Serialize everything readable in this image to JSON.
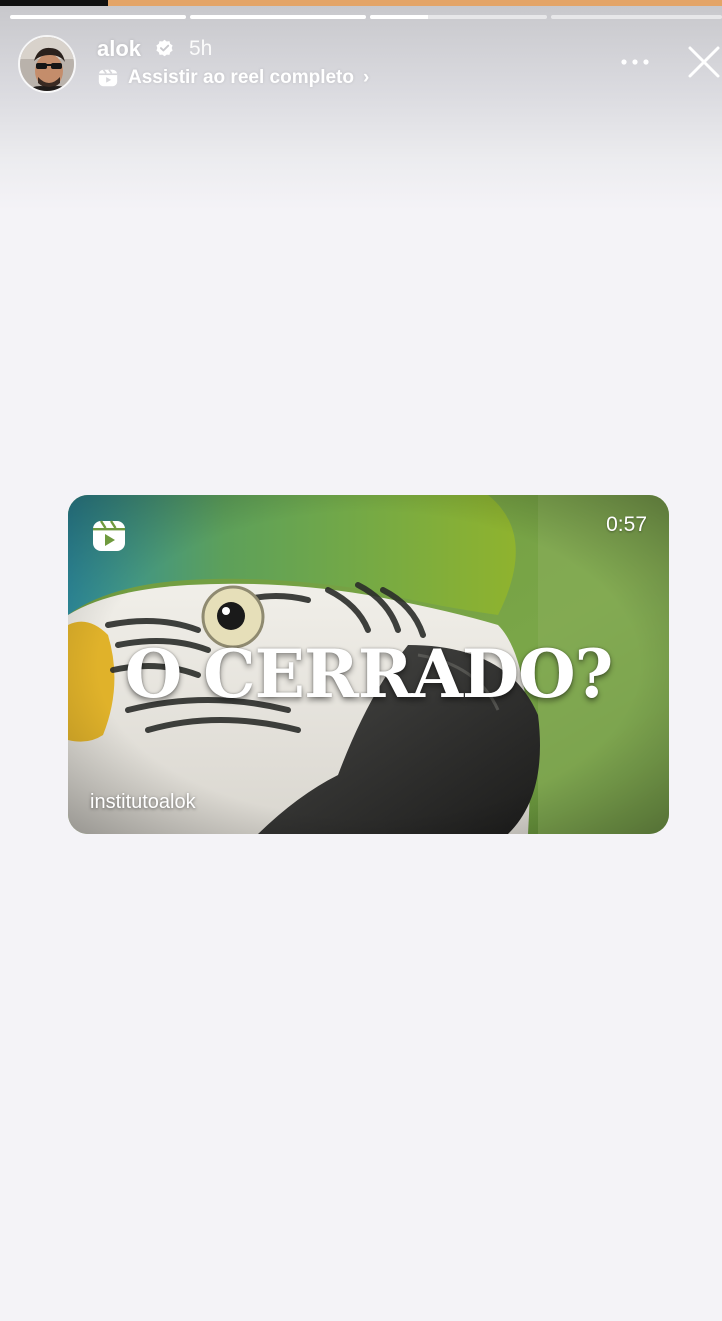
{
  "story": {
    "user": "alok",
    "time_ago": "5h",
    "reel_link_label": "Assistir ao reel completo",
    "reel_link_chevron": "›",
    "progress_segments": [
      1,
      1,
      0.33,
      0
    ],
    "icons": {
      "verified": "verified-badge-icon",
      "reel_link": "reels-icon",
      "more": "more-dots-icon",
      "close": "close-icon"
    },
    "colors": {
      "top_strip": "#e3a467",
      "background": "#f4f3f7"
    }
  },
  "reel_card": {
    "duration": "0:57",
    "headline": "O CERRADO?",
    "author": "institutoalok",
    "icon": "reels-icon"
  }
}
